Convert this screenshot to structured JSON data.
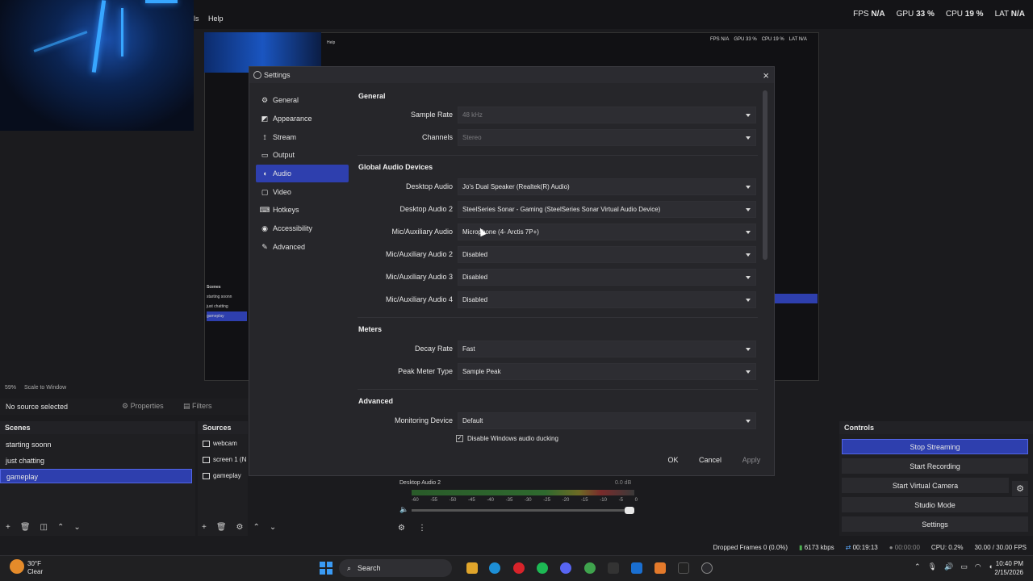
{
  "obs": {
    "menu": {
      "tools_partial": "ls",
      "help": "Help"
    },
    "top_stats": {
      "fps_label": "FPS",
      "fps_value": "N/A",
      "gpu_label": "GPU",
      "gpu_value": "33 %",
      "cpu_label": "CPU",
      "cpu_value": "19 %",
      "lat_label": "LAT",
      "lat_value": "N/A"
    },
    "nested_stats": [
      "FPS N/A",
      "GPU 33 %",
      "CPU 19 %",
      "LAT N/A"
    ],
    "nested_help": "Help",
    "preview_zoom": "59%",
    "preview_scale": "Scale to Window",
    "no_source": "No source selected",
    "properties_label": "Properties",
    "filters_label": "Filters",
    "scenes": {
      "title": "Scenes",
      "items": [
        "starting soonn",
        "just chatting",
        "gameplay"
      ],
      "selected_index": 2
    },
    "sources": {
      "title": "Sources",
      "items": [
        "webcam",
        "screen 1 (N",
        "gameplay"
      ]
    },
    "mixer": {
      "channel": "Desktop Audio 2",
      "db": "0.0 dB",
      "ticks": [
        "-60",
        "-55",
        "-50",
        "-45",
        "-40",
        "-35",
        "-30",
        "-25",
        "-20",
        "-15",
        "-10",
        "-5",
        "0"
      ]
    },
    "controls": {
      "title": "Controls",
      "buttons": [
        "Stop Streaming",
        "Start Recording",
        "Start Virtual Camera",
        "Studio Mode",
        "Settings"
      ]
    },
    "status": {
      "dropped": "Dropped Frames 0 (0.0%)",
      "kbps": "6173 kbps",
      "stream_time": "00:19:13",
      "rec_time": "00:00:00",
      "cpu": "CPU: 0.2%",
      "fps": "30.00 / 30.00 FPS"
    }
  },
  "settings": {
    "title": "Settings",
    "nav": [
      {
        "label": "General",
        "icon": "gear-icon"
      },
      {
        "label": "Appearance",
        "icon": "appearance-icon"
      },
      {
        "label": "Stream",
        "icon": "antenna-icon"
      },
      {
        "label": "Output",
        "icon": "output-icon"
      },
      {
        "label": "Audio",
        "icon": "speaker-icon",
        "active": true
      },
      {
        "label": "Video",
        "icon": "monitor-icon"
      },
      {
        "label": "Hotkeys",
        "icon": "keyboard-icon"
      },
      {
        "label": "Accessibility",
        "icon": "accessibility-icon"
      },
      {
        "label": "Advanced",
        "icon": "wrench-icon"
      }
    ],
    "sections": {
      "general": {
        "title": "General",
        "sample_rate_label": "Sample Rate",
        "sample_rate_value": "48 kHz",
        "channels_label": "Channels",
        "channels_value": "Stereo"
      },
      "global_audio": {
        "title": "Global Audio Devices",
        "rows": [
          {
            "label": "Desktop Audio",
            "value": "Jo's Dual Speaker (Realtek(R) Audio)"
          },
          {
            "label": "Desktop Audio 2",
            "value": "SteelSeries Sonar - Gaming (SteelSeries Sonar Virtual Audio Device)"
          },
          {
            "label": "Mic/Auxiliary Audio",
            "value": "Microphone (4- Arctis 7P+)"
          },
          {
            "label": "Mic/Auxiliary Audio 2",
            "value": "Disabled"
          },
          {
            "label": "Mic/Auxiliary Audio 3",
            "value": "Disabled"
          },
          {
            "label": "Mic/Auxiliary Audio 4",
            "value": "Disabled"
          }
        ]
      },
      "meters": {
        "title": "Meters",
        "decay_label": "Decay Rate",
        "decay_value": "Fast",
        "peak_label": "Peak Meter Type",
        "peak_value": "Sample Peak"
      },
      "advanced": {
        "title": "Advanced",
        "monitoring_label": "Monitoring Device",
        "monitoring_value": "Default",
        "ducking_label": "Disable Windows audio ducking",
        "ducking_checked": true
      }
    },
    "buttons": {
      "ok": "OK",
      "cancel": "Cancel",
      "apply": "Apply"
    }
  },
  "taskbar": {
    "weather_temp": "30°F",
    "weather_desc": "Clear",
    "search_placeholder": "Search",
    "time": "10:40 PM",
    "date": "2/15/2026"
  },
  "colors": {
    "accent": "#2e3fae",
    "background": "#1b1b1e",
    "dialog": "#26262a"
  }
}
